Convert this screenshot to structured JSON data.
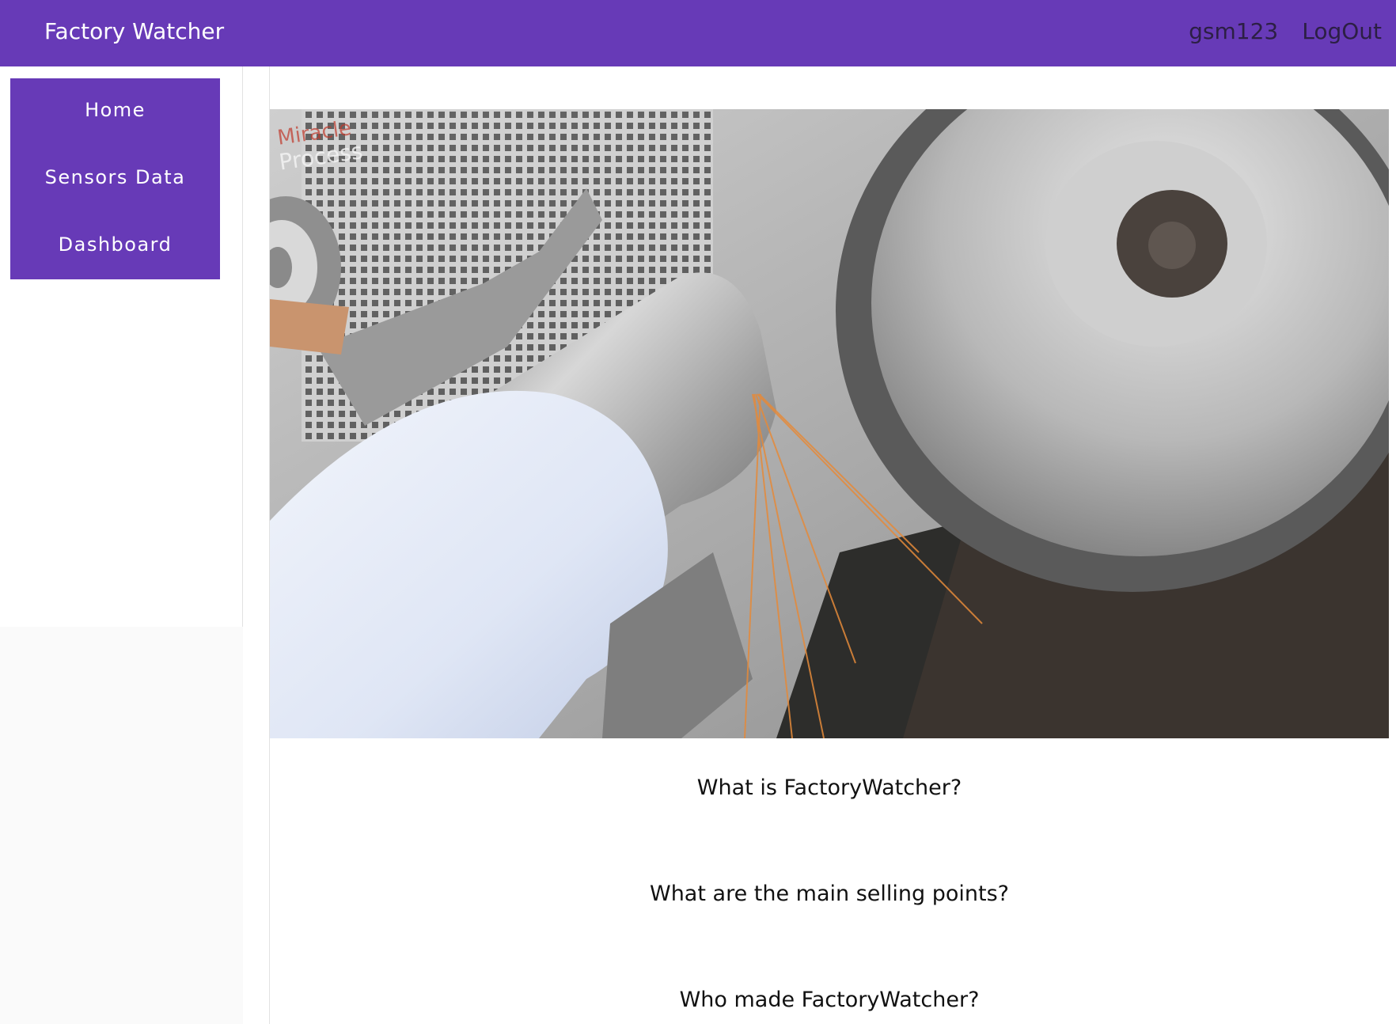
{
  "header": {
    "app_title": "Factory Watcher",
    "username": "gsm123",
    "logout_label": "LogOut"
  },
  "sidebar": {
    "items": [
      {
        "label": "Home"
      },
      {
        "label": "Sensors Data"
      },
      {
        "label": "Dashboard"
      }
    ]
  },
  "main": {
    "hero_image": {
      "watermark_line1": "Miracle",
      "watermark_line2": "Process"
    },
    "faq": [
      {
        "question": "What is FactoryWatcher?"
      },
      {
        "question": "What are the main selling points?"
      },
      {
        "question": "Who made FactoryWatcher?"
      }
    ]
  },
  "colors": {
    "primary": "#673ab7",
    "header_user_text": "#2c1f44"
  }
}
